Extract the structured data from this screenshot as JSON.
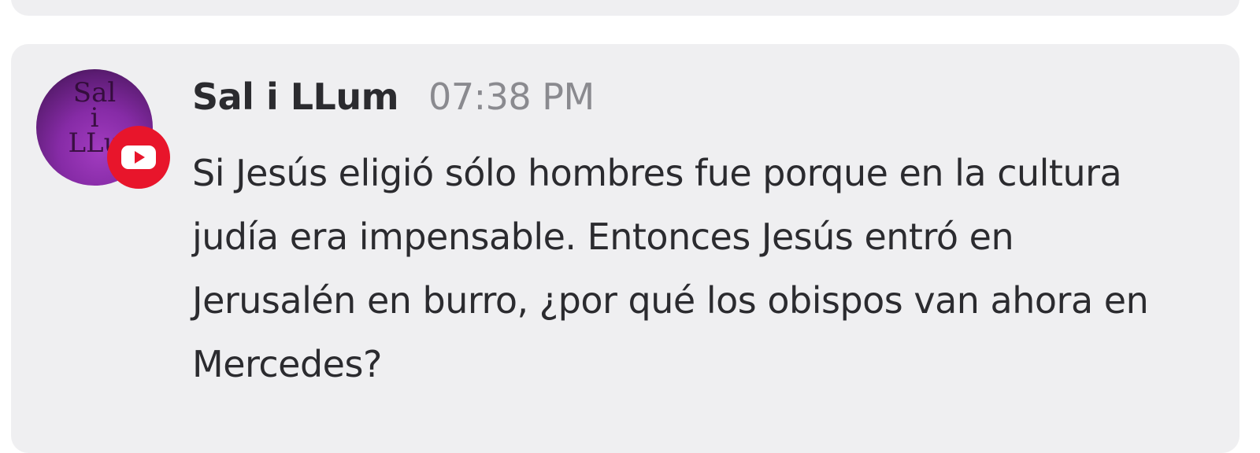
{
  "message": {
    "author": "Sal i LLum",
    "timestamp": "07:38 PM",
    "text": "Si Jesús eligió sólo hombres fue porque en la cultura judía era impensable. Entonces Jesús entró en Jerusalén en burro, ¿por qué los obispos van ahora en Mercedes?",
    "avatar": {
      "text": "Sal\ni\nLLu",
      "badge_icon": "youtube-icon"
    }
  },
  "colors": {
    "card_background": "#efeff1",
    "author": "#2b2b2f",
    "timestamp": "#8a8a8f",
    "badge": "#e8152b",
    "avatar": "#862ba6"
  }
}
